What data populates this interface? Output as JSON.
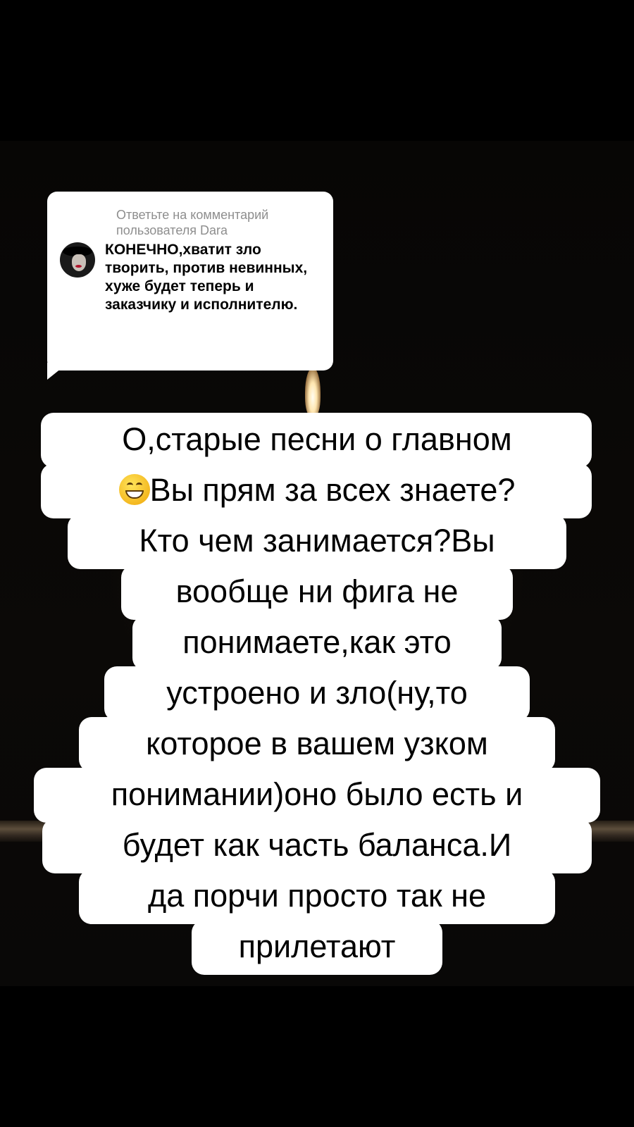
{
  "reply_card": {
    "header": "Ответьте на комментарий пользователя Dara",
    "comment_text": "КОНЕЧНО,хватит зло творить, против невинных, хуже будет теперь и заказчику и исполнителю."
  },
  "caption": {
    "lines": [
      "О,старые песни о главном",
      "Вы прям за всех знаете?",
      "Кто чем занимается?Вы",
      "вообще ни фига не",
      "понимаете,как это",
      "устроено и зло(ну,то",
      "которое в вашем узком",
      "понимании)оно было есть и",
      "будет как часть баланса.И",
      "да порчи просто так не",
      "прилетают"
    ],
    "emoji": "grinning-face-icon"
  }
}
